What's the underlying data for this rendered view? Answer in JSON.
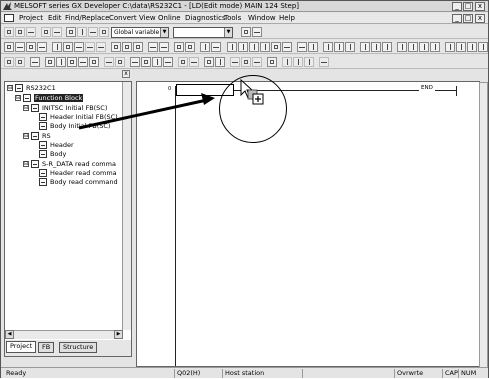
{
  "window": {
    "title": "MELSOFT series GX Developer C:\\data\\RS232C1 - [LD(Edit mode)    MAIN   124 Step]",
    "minimize": "_",
    "maximize": "□",
    "close": "x"
  },
  "menu": {
    "items": [
      "Project",
      "Edit",
      "Find/Replace",
      "Convert",
      "View",
      "Online",
      "Diagnostics",
      "Tools",
      "Window",
      "Help"
    ],
    "child_controls": [
      "_",
      "□",
      "x"
    ]
  },
  "toolbar": {
    "variable_mode": "Global variable",
    "device_combo": ""
  },
  "project_tree": {
    "pane_close": "x",
    "nodes": [
      {
        "label": "RS232C1",
        "icon": "project-icon",
        "toggle": "⊟"
      },
      {
        "label": "Function Block",
        "icon": "folder-icon",
        "toggle": "⊟",
        "selected": true
      },
      {
        "label": "INITSC Initial FB(SC)",
        "icon": "fb-icon",
        "toggle": "⊟"
      },
      {
        "label": "Header Initial FB(SC)",
        "icon": "header-icon"
      },
      {
        "label": "Body Initial FB(SC)",
        "icon": "body-icon"
      },
      {
        "label": "RS",
        "icon": "fb-icon",
        "toggle": "⊟"
      },
      {
        "label": "Header",
        "icon": "header-icon"
      },
      {
        "label": "Body",
        "icon": "body-icon"
      },
      {
        "label": "S-R_DATA read comma",
        "icon": "fb-icon",
        "toggle": "⊟"
      },
      {
        "label": "Header read comma",
        "icon": "header-icon"
      },
      {
        "label": "Body read command",
        "icon": "body-icon"
      }
    ],
    "tabs": [
      "Project",
      "FB",
      "Structure"
    ]
  },
  "editor": {
    "step": "0",
    "end_instruction": "END"
  },
  "status": {
    "ready": "Ready",
    "cpu": "Q02(H)",
    "station": "Host station",
    "mode": "Ovrwrte",
    "caps": "CAP",
    "num": "NUM"
  }
}
